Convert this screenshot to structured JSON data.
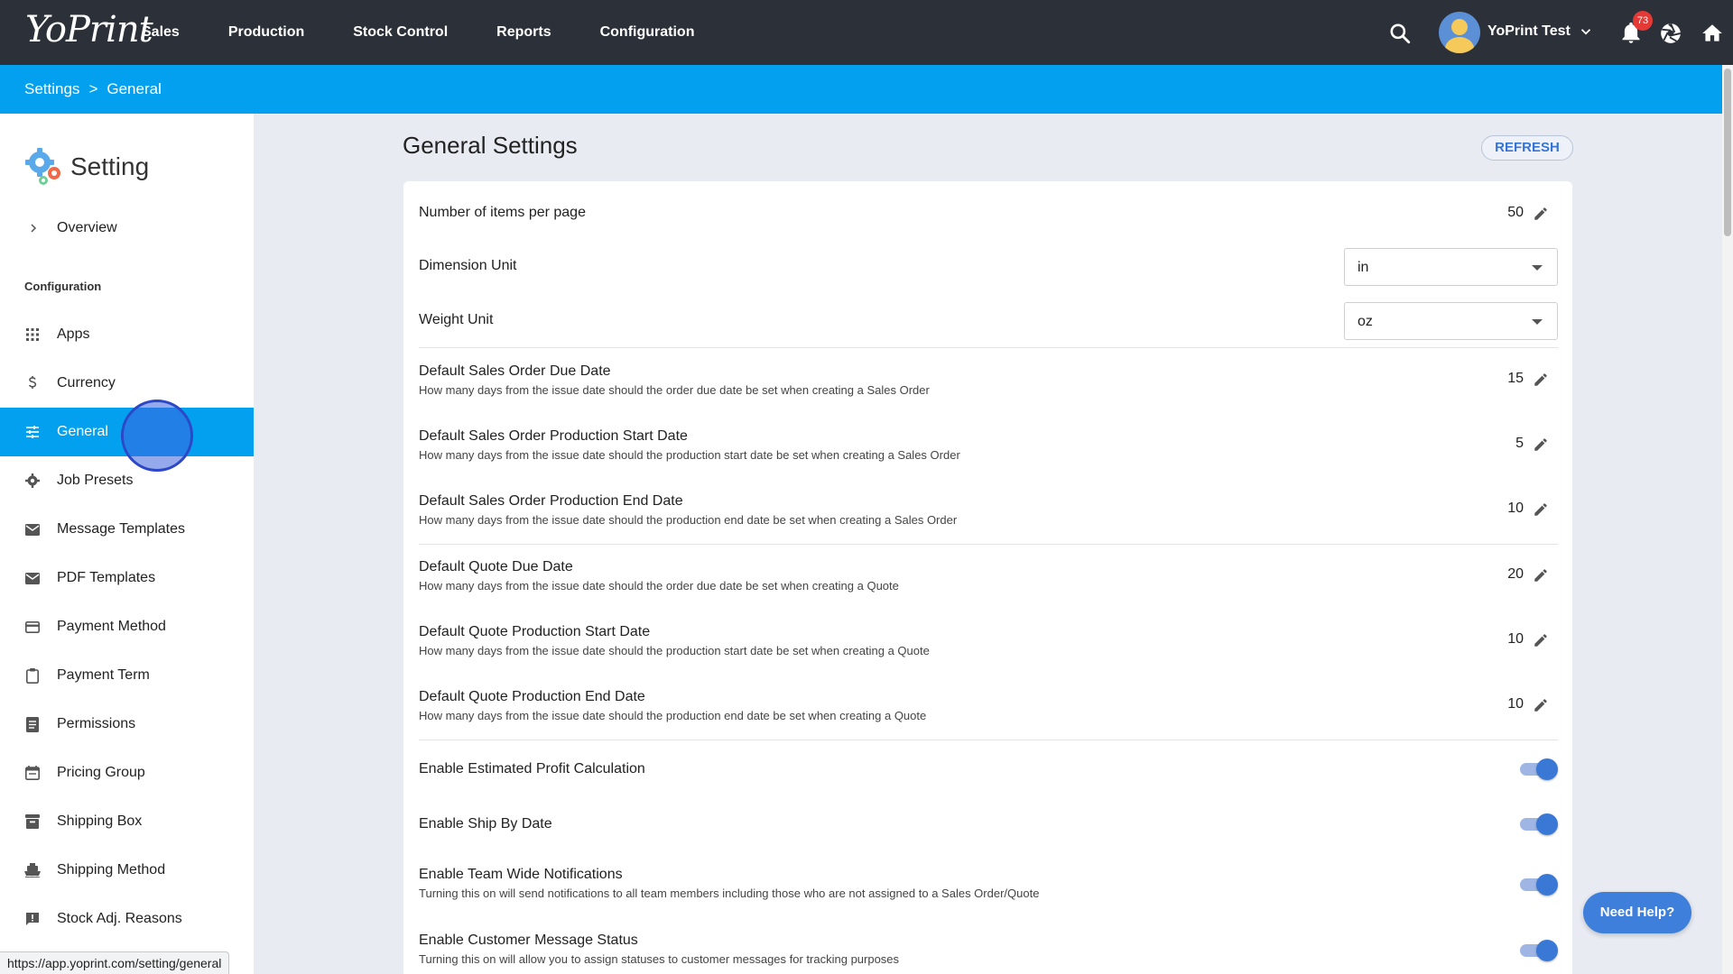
{
  "app": {
    "logo_text": "YoPrint"
  },
  "nav": {
    "items": [
      "Sales",
      "Production",
      "Stock Control",
      "Reports",
      "Configuration"
    ]
  },
  "user": {
    "name": "YoPrint Test",
    "notifications": "73"
  },
  "breadcrumb": {
    "items": [
      "Settings",
      "General"
    ],
    "separator": ">"
  },
  "sidebar": {
    "title": "Setting",
    "overview_label": "Overview",
    "section_label": "Configuration",
    "items": [
      {
        "label": "Apps",
        "icon": "apps-grid-icon"
      },
      {
        "label": "Currency",
        "icon": "dollar-icon"
      },
      {
        "label": "General",
        "icon": "sliders-icon",
        "active": true
      },
      {
        "label": "Job Presets",
        "icon": "gear-icon"
      },
      {
        "label": "Message Templates",
        "icon": "mail-icon"
      },
      {
        "label": "PDF Templates",
        "icon": "mail-icon"
      },
      {
        "label": "Payment Method",
        "icon": "credit-card-icon"
      },
      {
        "label": "Payment Term",
        "icon": "clipboard-icon"
      },
      {
        "label": "Permissions",
        "icon": "list-icon"
      },
      {
        "label": "Pricing Group",
        "icon": "calendar-icon"
      },
      {
        "label": "Shipping Box",
        "icon": "archive-icon"
      },
      {
        "label": "Shipping Method",
        "icon": "ship-icon"
      },
      {
        "label": "Stock Adj. Reasons",
        "icon": "alert-icon"
      }
    ]
  },
  "main": {
    "title": "General Settings",
    "refresh_label": "REFRESH",
    "settings": {
      "items_per_page": {
        "title": "Number of items per page",
        "value": "50"
      },
      "dimension_unit": {
        "title": "Dimension Unit",
        "value": "in"
      },
      "weight_unit": {
        "title": "Weight Unit",
        "value": "oz"
      },
      "so_due": {
        "title": "Default Sales Order Due Date",
        "desc": "How many days from the issue date should the order due date be set when creating a Sales Order",
        "value": "15"
      },
      "so_prod_start": {
        "title": "Default Sales Order Production Start Date",
        "desc": "How many days from the issue date should the production start date be set when creating a Sales Order",
        "value": "5"
      },
      "so_prod_end": {
        "title": "Default Sales Order Production End Date",
        "desc": "How many days from the issue date should the production end date be set when creating a Sales Order",
        "value": "10"
      },
      "q_due": {
        "title": "Default Quote Due Date",
        "desc": "How many days from the issue date should the order due date be set when creating a Quote",
        "value": "20"
      },
      "q_prod_start": {
        "title": "Default Quote Production Start Date",
        "desc": "How many days from the issue date should the production start date be set when creating a Quote",
        "value": "10"
      },
      "q_prod_end": {
        "title": "Default Quote Production End Date",
        "desc": "How many days from the issue date should the production end date be set when creating a Quote",
        "value": "10"
      },
      "profit_calc": {
        "title": "Enable Estimated Profit Calculation",
        "enabled": true
      },
      "ship_by": {
        "title": "Enable Ship By Date",
        "enabled": true
      },
      "team_notif": {
        "title": "Enable Team Wide Notifications",
        "desc": "Turning this on will send notifications to all team members including those who are not assigned to a Sales Order/Quote",
        "enabled": true
      },
      "cust_msg_status": {
        "title": "Enable Customer Message Status",
        "desc": "Turning this on will allow you to assign statuses to customer messages for tracking purposes",
        "enabled": true
      }
    }
  },
  "help_button": "Need Help?",
  "status_url": "https://app.yoprint.com/setting/general",
  "colors": {
    "topbar": "#2c3038",
    "accent_blue": "#03a0ef",
    "toggle_on": "#3a78d6",
    "badge": "#e53935"
  }
}
